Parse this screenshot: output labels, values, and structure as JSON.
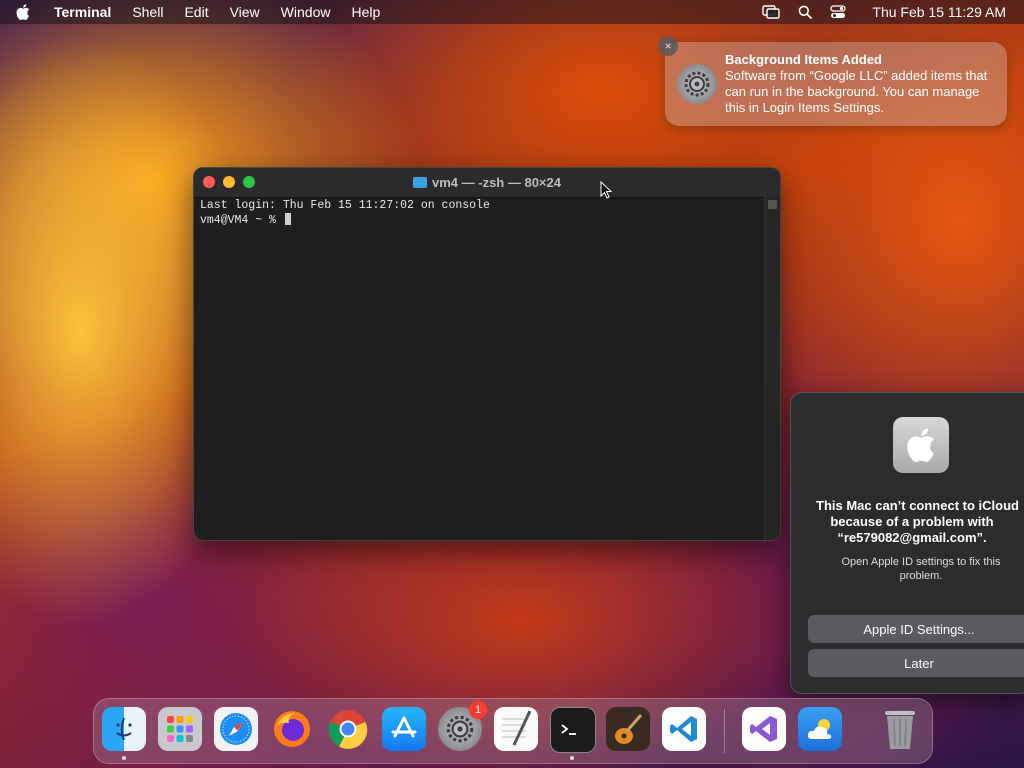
{
  "menubar": {
    "app_name": "Terminal",
    "menus": [
      "Shell",
      "Edit",
      "View",
      "Window",
      "Help"
    ],
    "clock": "Thu Feb 15  11:29 AM"
  },
  "notification": {
    "title": "Background Items Added",
    "body": "Software from “Google LLC” added items that can run in the background. You can manage this in Login Items Settings.",
    "close_glyph": "×"
  },
  "terminal": {
    "title": "vm4 — -zsh — 80×24",
    "lines": [
      "Last login: Thu Feb 15 11:27:02 on console",
      "vm4@VM4 ~ % "
    ]
  },
  "icloud_dialog": {
    "title_lines": [
      "This Mac can’t connect to iCloud",
      "because of a problem with",
      "“re579082@gmail.com”."
    ],
    "message": "Open Apple ID settings to fix this problem.",
    "primary_button": "Apple ID Settings...",
    "secondary_button": "Later"
  },
  "dock": {
    "apps": [
      {
        "name": "Finder",
        "running": true
      },
      {
        "name": "Launchpad",
        "running": false
      },
      {
        "name": "Safari",
        "running": false
      },
      {
        "name": "Firefox",
        "running": false
      },
      {
        "name": "Google Chrome",
        "running": false
      },
      {
        "name": "App Store",
        "running": false
      },
      {
        "name": "System Settings",
        "running": false,
        "badge": "1"
      },
      {
        "name": "TextEdit",
        "running": false
      },
      {
        "name": "Terminal",
        "running": true
      },
      {
        "name": "GarageBand",
        "running": false
      },
      {
        "name": "Visual Studio Code",
        "running": false
      },
      {
        "name": "Visual Studio",
        "running": false
      },
      {
        "name": "Weather",
        "running": false
      },
      {
        "name": "Trash",
        "running": false
      }
    ]
  },
  "colors": {
    "close": "#ff5f57",
    "minimize": "#febc2e",
    "maximize": "#28c840",
    "badge": "#ff3b30"
  }
}
